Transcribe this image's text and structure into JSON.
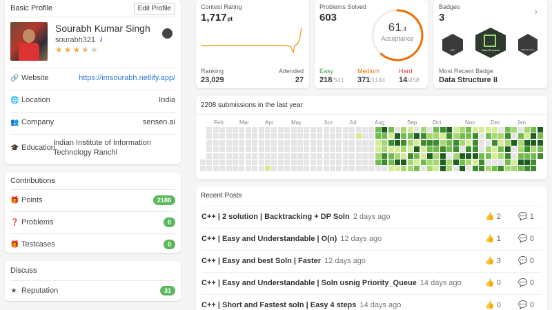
{
  "profile": {
    "title": "Basic Profile",
    "edit": "Edit Profile",
    "name": "Sourabh Kumar Singh",
    "username": "sourabh321",
    "info": "i",
    "stars": 3.5
  },
  "details": [
    {
      "icon": "🔗",
      "label": "Website",
      "value": "https://imsourabh.netlify.app/",
      "link": true
    },
    {
      "icon": "🌐",
      "label": "Location",
      "value": "India"
    },
    {
      "icon": "👥",
      "label": "Company",
      "value": "sensen.ai"
    },
    {
      "icon": "🎓",
      "label": "Education",
      "value": "Indian Institute of Information Technology Ranchi"
    }
  ],
  "contributions": {
    "title": "Contributions",
    "items": [
      {
        "label": "Points",
        "value": "2186"
      },
      {
        "label": "Problems",
        "value": "0"
      },
      {
        "label": "Testcases",
        "value": "0"
      }
    ]
  },
  "discuss": {
    "title": "Discuss",
    "items": [
      {
        "label": "Reputation",
        "value": "31"
      }
    ]
  },
  "contest": {
    "title": "Contest Rating",
    "rating": "1,717",
    "unit": "pt",
    "ranking_label": "Ranking",
    "ranking": "23,029",
    "attended_label": "Attended",
    "attended": "27"
  },
  "solved": {
    "title": "Problems Solved",
    "total": "603",
    "pct": "61",
    "pct_frac": ".4",
    "acc": "Acceptance",
    "acceptance_pct": 61.4,
    "easy": {
      "label": "Easy",
      "v": "218",
      "t": "/541",
      "color": "#43a047"
    },
    "medium": {
      "label": "Medium",
      "v": "371",
      "t": "/1144",
      "color": "#ef6c00"
    },
    "hard": {
      "label": "Hard",
      "v": "14",
      "t": "/458",
      "color": "#e53935"
    }
  },
  "badges": {
    "title": "Badges",
    "count": "3",
    "items": [
      "DP",
      "Data Structure",
      "Data Structure"
    ],
    "recent_label": "Most Recent Badge",
    "recent": "Data Structure II"
  },
  "heatmap": {
    "title": "2208 submissions in the last year",
    "months": [
      "Feb",
      "Mar",
      "Apr",
      "May",
      "Jun",
      "Jul",
      "Aug",
      "Sep",
      "Oct",
      "Nov",
      "Dec",
      "Jan"
    ],
    "colors": [
      "#e5e5e5",
      "#d4ec97",
      "#a5d86e",
      "#72bc4e",
      "#3c8b2f",
      "#1f5e21"
    ]
  },
  "posts": {
    "title": "Recent Posts",
    "items": [
      {
        "title": "C++ | 2 solution | Backtracking + DP Soln",
        "date": "2 days ago",
        "likes": "2",
        "comments": "1"
      },
      {
        "title": "C++ | Easy and Understandable | O(n)",
        "date": "12 days ago",
        "likes": "1",
        "comments": "0"
      },
      {
        "title": "C++ | Easy and best Soln | Faster",
        "date": "12 days ago",
        "likes": "3",
        "comments": "0"
      },
      {
        "title": "C++ | Easy and Understandable | Soln usnig Priority_Queue",
        "date": "14 days ago",
        "likes": "0",
        "comments": "0"
      },
      {
        "title": "C++ | Short and Fastest soln | Easy 4 steps",
        "date": "14 days ago",
        "likes": "0",
        "comments": "0"
      }
    ]
  }
}
